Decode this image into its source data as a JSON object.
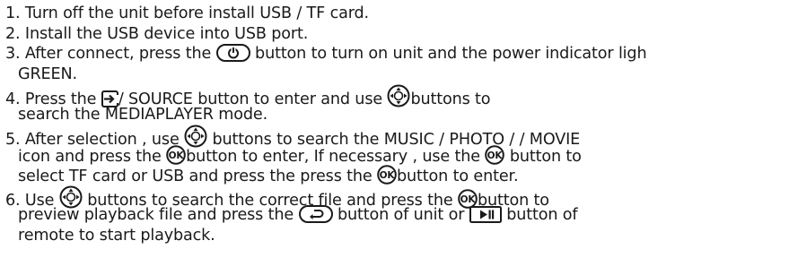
{
  "instructions": {
    "l1": "1. Turn off the unit before install USB / TF card.",
    "l2": "2. Install the USB device into USB port.",
    "l3a": "3. After connect, press the",
    "l3b": "button to turn on unit and the power indicator ligh",
    "l3c": "GREEN.",
    "l4a": "4. Press the",
    "l4b": "/ SOURCE  button to enter and use",
    "l4c": "buttons to",
    "l4d": "search the MEDIAPLAYER mode.",
    "l5a": "5. After selection , use",
    "l5b": "buttons to search the MUSIC / PHOTO / / MOVIE",
    "l5c": "icon and press the",
    "l5d": "button to enter, If necessary , use the",
    "l5e": "button to",
    "l5f": "select TF card or USB and press the press the",
    "l5g": "button to enter.",
    "l6a": "6. Use",
    "l6b": "buttons to search the correct file and press the",
    "l6c": "button to",
    "l6d": "preview playback file and press the",
    "l6e": "button of unit or",
    "l6f": "button of",
    "l6g": "remote to start playback."
  },
  "icons": {
    "ok_label": "OK",
    "color": "#1a1a1a"
  }
}
